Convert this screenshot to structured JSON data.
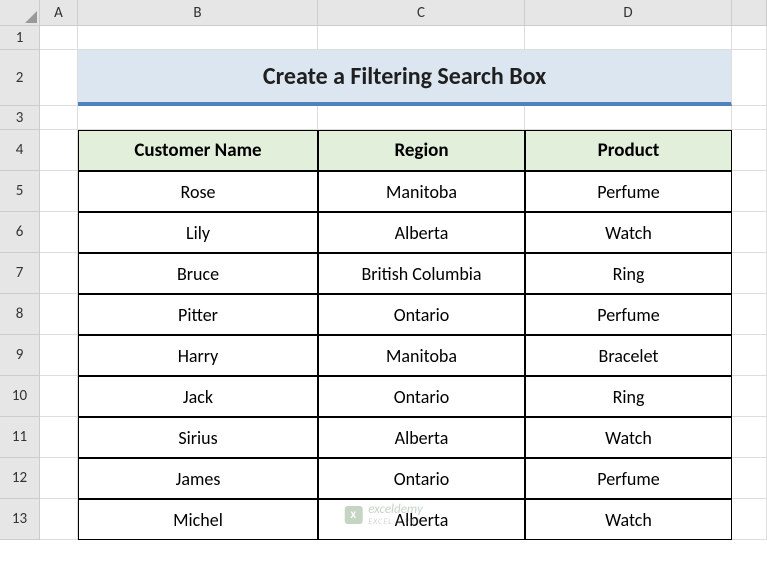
{
  "columns": [
    "A",
    "B",
    "C",
    "D"
  ],
  "rows": [
    "1",
    "2",
    "3",
    "4",
    "5",
    "6",
    "7",
    "8",
    "9",
    "10",
    "11",
    "12",
    "13"
  ],
  "title": "Create a Filtering Search Box",
  "table": {
    "headers": [
      "Customer Name",
      "Region",
      "Product"
    ],
    "data": [
      [
        "Rose",
        "Manitoba",
        "Perfume"
      ],
      [
        "Lily",
        "Alberta",
        "Watch"
      ],
      [
        "Bruce",
        "British Columbia",
        "Ring"
      ],
      [
        "Pitter",
        "Ontario",
        "Perfume"
      ],
      [
        "Harry",
        "Manitoba",
        "Bracelet"
      ],
      [
        "Jack",
        "Ontario",
        "Ring"
      ],
      [
        "Sirius",
        "Alberta",
        "Watch"
      ],
      [
        "James",
        "Ontario",
        "Perfume"
      ],
      [
        "Michel",
        "Alberta",
        "Watch"
      ]
    ]
  },
  "watermark": {
    "text": "exceldemy",
    "sub": "EXCEL & VBA"
  }
}
